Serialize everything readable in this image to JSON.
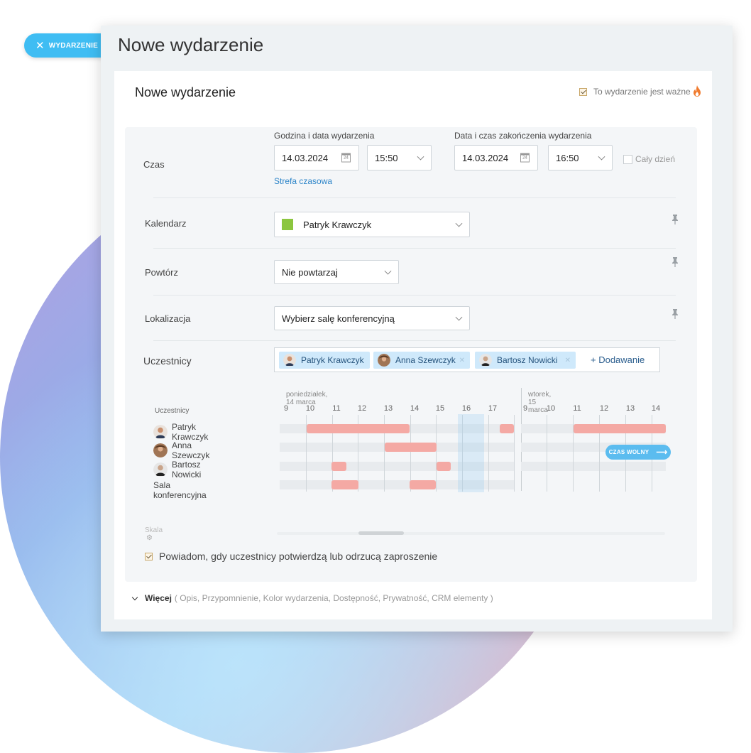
{
  "side_tab": {
    "label": "WYDARZENIE"
  },
  "window": {
    "title": "Nowe wydarzenie"
  },
  "card": {
    "title": "Nowe wydarzenie",
    "important_label": "To wydarzenie jest ważne",
    "important_checked": true
  },
  "time": {
    "label": "Czas",
    "start_heading": "Godzina i data wydarzenia",
    "start_date": "14.03.2024",
    "start_time": "15:50",
    "end_heading": "Data i czas zakończenia wydarzenia",
    "end_date": "14.03.2024",
    "end_time": "16:50",
    "all_day_label": "Cały dzień",
    "all_day_checked": false,
    "timezone_link": "Strefa czasowa"
  },
  "calendar": {
    "label": "Kalendarz",
    "value": "Patryk Krawczyk",
    "color": "#8cc63f"
  },
  "repeat": {
    "label": "Powtórz",
    "value": "Nie powtarzaj"
  },
  "location": {
    "label": "Lokalizacja",
    "value": "Wybierz salę konferencyjną"
  },
  "participants": {
    "label": "Uczestnicy",
    "chips": [
      "Patryk Krawczyk",
      "Anna Szewczyk",
      "Bartosz Nowicki"
    ],
    "add_label": "+ Dodawanie"
  },
  "timeline": {
    "rows_header": "Uczestnicy",
    "day1": "poniedziałek, 14 marca",
    "day2": "wtorek, 15 marca",
    "day1_hours": [
      "9",
      "10",
      "11",
      "12",
      "13",
      "14",
      "15",
      "16",
      "17"
    ],
    "day2_hours": [
      "9",
      "10",
      "11",
      "12",
      "13",
      "14"
    ],
    "rows": [
      "Patryk Krawczyk",
      "Anna Szewczyk",
      "Bartosz Nowicki",
      "Sala konferencyjna"
    ],
    "free_time_label": "CZAS WOLNY",
    "scale_label": "Skala"
  },
  "notify": {
    "label": "Powiadom, gdy uczestnicy potwierdzą lub odrzucą zaproszenie",
    "checked": true
  },
  "more": {
    "label": "Więcej",
    "details": "( Opis, Przypomnienie, Kolor wydarzenia, Dostępność, Prywatność, CRM elementy )"
  },
  "colors": {
    "accent": "#3fbdf3",
    "busy": "#f4a9a4",
    "chip": "#cfe9fb",
    "link": "#2f86c9"
  }
}
